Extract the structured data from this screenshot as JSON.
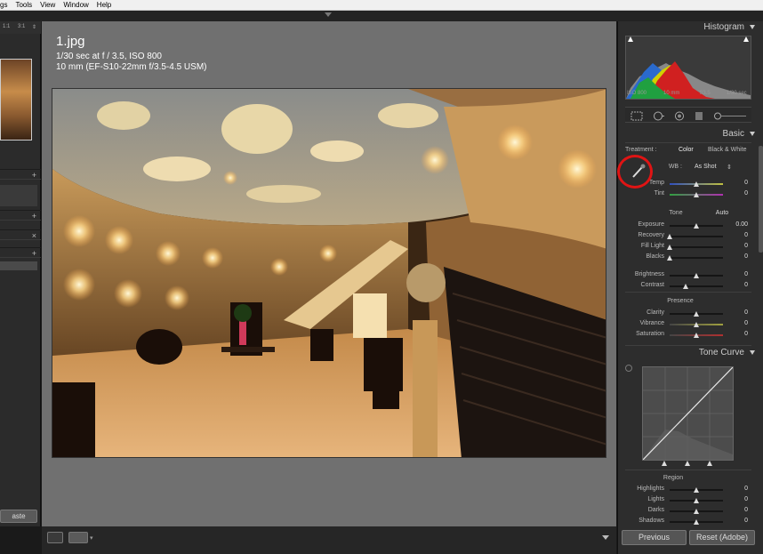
{
  "menubar": {
    "items": [
      "gs",
      "Tools",
      "View",
      "Window",
      "Help"
    ]
  },
  "left_panel": {
    "zoom": [
      "1:1",
      "3:1"
    ],
    "paste_label": "aste"
  },
  "photo_info": {
    "filename": "1.jpg",
    "exposure": "1/30 sec at f / 3.5, ISO 800",
    "lens": "10 mm (EF-S10-22mm f/3.5-4.5 USM)"
  },
  "histogram": {
    "title": "Histogram",
    "iso": "ISO 800",
    "focal": "10 mm",
    "aperture": "f/3.5",
    "shutter": "1/30 sec"
  },
  "basic": {
    "title": "Basic",
    "treatment_label": "Treatment :",
    "color_label": "Color",
    "bw_label": "Black & White",
    "wb_label": "WB :",
    "wb_value": "As Shot",
    "tone_label": "Tone",
    "auto_label": "Auto",
    "presence_label": "Presence",
    "sliders": [
      {
        "name": "Temp",
        "value": "0",
        "pos": 0.5
      },
      {
        "name": "Tint",
        "value": "0",
        "pos": 0.5
      },
      {
        "name": "Exposure",
        "value": "0.00",
        "pos": 0.5
      },
      {
        "name": "Recovery",
        "value": "0",
        "pos": 0.0
      },
      {
        "name": "Fill Light",
        "value": "0",
        "pos": 0.0
      },
      {
        "name": "Blacks",
        "value": "0",
        "pos": 0.0
      },
      {
        "name": "Brightness",
        "value": "0",
        "pos": 0.5
      },
      {
        "name": "Contrast",
        "value": "0",
        "pos": 0.3
      },
      {
        "name": "Clarity",
        "value": "0",
        "pos": 0.5
      },
      {
        "name": "Vibrance",
        "value": "0",
        "pos": 0.5
      },
      {
        "name": "Saturation",
        "value": "0",
        "pos": 0.5
      }
    ]
  },
  "tone_curve": {
    "title": "Tone Curve",
    "region_label": "Region",
    "sliders": [
      {
        "name": "Highlights",
        "value": "0",
        "pos": 0.5
      },
      {
        "name": "Lights",
        "value": "0",
        "pos": 0.5
      },
      {
        "name": "Darks",
        "value": "0",
        "pos": 0.5
      },
      {
        "name": "Shadows",
        "value": "0",
        "pos": 0.5
      }
    ]
  },
  "buttons": {
    "previous": "Previous",
    "reset": "Reset (Adobe)"
  },
  "colors": {
    "highlight_circle": "#e01414",
    "panel_bg": "#2d2d2d",
    "center_bg": "#707070"
  },
  "icons": [
    "white-balance-eyedropper-icon",
    "crop-icon",
    "spot-removal-icon",
    "red-eye-icon",
    "graduated-filter-icon",
    "adjustment-brush-icon"
  ]
}
